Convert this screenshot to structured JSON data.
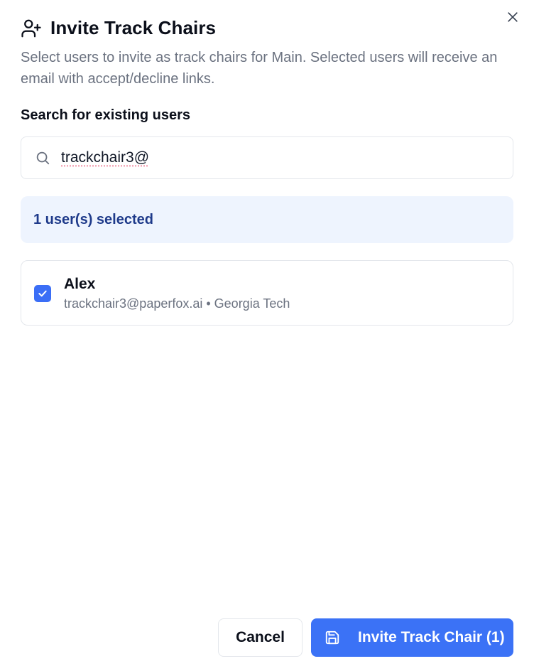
{
  "dialog": {
    "title": "Invite Track Chairs",
    "title_icon": "user-plus-icon",
    "close_icon": "close-icon",
    "description": "Select users to invite as track chairs for Main. Selected users will receive an email with accept/decline links."
  },
  "search": {
    "label": "Search for existing users",
    "icon": "search-icon",
    "value": "trackchair3@"
  },
  "selection": {
    "summary": "1 user(s) selected"
  },
  "users": [
    {
      "name": "Alex",
      "details": "trackchair3@paperfox.ai • Georgia Tech",
      "checked": true
    }
  ],
  "actions": {
    "cancel_label": "Cancel",
    "invite_label": "Invite Track Chair (1)",
    "invite_icon": "save-icon"
  },
  "colors": {
    "accent": "#3b72f6",
    "banner_bg": "#eef4fe",
    "banner_text": "#1e3a8a",
    "muted_text": "#6b7280"
  }
}
